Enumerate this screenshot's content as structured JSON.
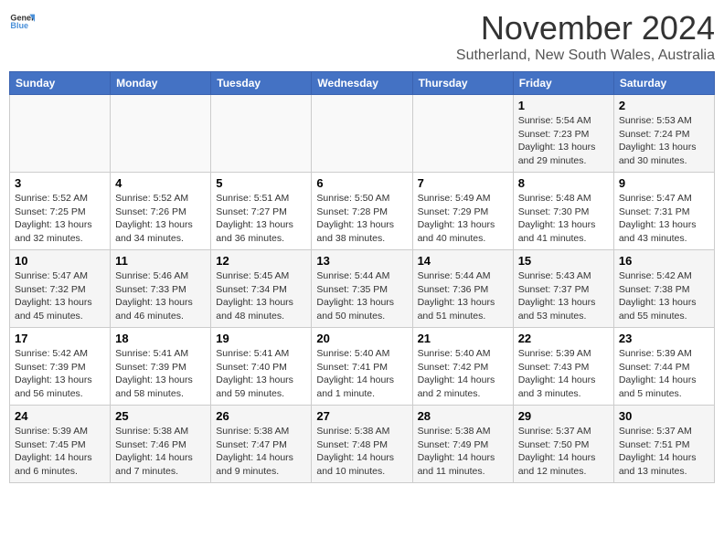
{
  "header": {
    "logo_general": "General",
    "logo_blue": "Blue",
    "month_title": "November 2024",
    "location": "Sutherland, New South Wales, Australia"
  },
  "calendar": {
    "days_of_week": [
      "Sunday",
      "Monday",
      "Tuesday",
      "Wednesday",
      "Thursday",
      "Friday",
      "Saturday"
    ],
    "weeks": [
      [
        {
          "day": "",
          "info": ""
        },
        {
          "day": "",
          "info": ""
        },
        {
          "day": "",
          "info": ""
        },
        {
          "day": "",
          "info": ""
        },
        {
          "day": "",
          "info": ""
        },
        {
          "day": "1",
          "info": "Sunrise: 5:54 AM\nSunset: 7:23 PM\nDaylight: 13 hours and 29 minutes."
        },
        {
          "day": "2",
          "info": "Sunrise: 5:53 AM\nSunset: 7:24 PM\nDaylight: 13 hours and 30 minutes."
        }
      ],
      [
        {
          "day": "3",
          "info": "Sunrise: 5:52 AM\nSunset: 7:25 PM\nDaylight: 13 hours and 32 minutes."
        },
        {
          "day": "4",
          "info": "Sunrise: 5:52 AM\nSunset: 7:26 PM\nDaylight: 13 hours and 34 minutes."
        },
        {
          "day": "5",
          "info": "Sunrise: 5:51 AM\nSunset: 7:27 PM\nDaylight: 13 hours and 36 minutes."
        },
        {
          "day": "6",
          "info": "Sunrise: 5:50 AM\nSunset: 7:28 PM\nDaylight: 13 hours and 38 minutes."
        },
        {
          "day": "7",
          "info": "Sunrise: 5:49 AM\nSunset: 7:29 PM\nDaylight: 13 hours and 40 minutes."
        },
        {
          "day": "8",
          "info": "Sunrise: 5:48 AM\nSunset: 7:30 PM\nDaylight: 13 hours and 41 minutes."
        },
        {
          "day": "9",
          "info": "Sunrise: 5:47 AM\nSunset: 7:31 PM\nDaylight: 13 hours and 43 minutes."
        }
      ],
      [
        {
          "day": "10",
          "info": "Sunrise: 5:47 AM\nSunset: 7:32 PM\nDaylight: 13 hours and 45 minutes."
        },
        {
          "day": "11",
          "info": "Sunrise: 5:46 AM\nSunset: 7:33 PM\nDaylight: 13 hours and 46 minutes."
        },
        {
          "day": "12",
          "info": "Sunrise: 5:45 AM\nSunset: 7:34 PM\nDaylight: 13 hours and 48 minutes."
        },
        {
          "day": "13",
          "info": "Sunrise: 5:44 AM\nSunset: 7:35 PM\nDaylight: 13 hours and 50 minutes."
        },
        {
          "day": "14",
          "info": "Sunrise: 5:44 AM\nSunset: 7:36 PM\nDaylight: 13 hours and 51 minutes."
        },
        {
          "day": "15",
          "info": "Sunrise: 5:43 AM\nSunset: 7:37 PM\nDaylight: 13 hours and 53 minutes."
        },
        {
          "day": "16",
          "info": "Sunrise: 5:42 AM\nSunset: 7:38 PM\nDaylight: 13 hours and 55 minutes."
        }
      ],
      [
        {
          "day": "17",
          "info": "Sunrise: 5:42 AM\nSunset: 7:39 PM\nDaylight: 13 hours and 56 minutes."
        },
        {
          "day": "18",
          "info": "Sunrise: 5:41 AM\nSunset: 7:39 PM\nDaylight: 13 hours and 58 minutes."
        },
        {
          "day": "19",
          "info": "Sunrise: 5:41 AM\nSunset: 7:40 PM\nDaylight: 13 hours and 59 minutes."
        },
        {
          "day": "20",
          "info": "Sunrise: 5:40 AM\nSunset: 7:41 PM\nDaylight: 14 hours and 1 minute."
        },
        {
          "day": "21",
          "info": "Sunrise: 5:40 AM\nSunset: 7:42 PM\nDaylight: 14 hours and 2 minutes."
        },
        {
          "day": "22",
          "info": "Sunrise: 5:39 AM\nSunset: 7:43 PM\nDaylight: 14 hours and 3 minutes."
        },
        {
          "day": "23",
          "info": "Sunrise: 5:39 AM\nSunset: 7:44 PM\nDaylight: 14 hours and 5 minutes."
        }
      ],
      [
        {
          "day": "24",
          "info": "Sunrise: 5:39 AM\nSunset: 7:45 PM\nDaylight: 14 hours and 6 minutes."
        },
        {
          "day": "25",
          "info": "Sunrise: 5:38 AM\nSunset: 7:46 PM\nDaylight: 14 hours and 7 minutes."
        },
        {
          "day": "26",
          "info": "Sunrise: 5:38 AM\nSunset: 7:47 PM\nDaylight: 14 hours and 9 minutes."
        },
        {
          "day": "27",
          "info": "Sunrise: 5:38 AM\nSunset: 7:48 PM\nDaylight: 14 hours and 10 minutes."
        },
        {
          "day": "28",
          "info": "Sunrise: 5:38 AM\nSunset: 7:49 PM\nDaylight: 14 hours and 11 minutes."
        },
        {
          "day": "29",
          "info": "Sunrise: 5:37 AM\nSunset: 7:50 PM\nDaylight: 14 hours and 12 minutes."
        },
        {
          "day": "30",
          "info": "Sunrise: 5:37 AM\nSunset: 7:51 PM\nDaylight: 14 hours and 13 minutes."
        }
      ]
    ]
  }
}
